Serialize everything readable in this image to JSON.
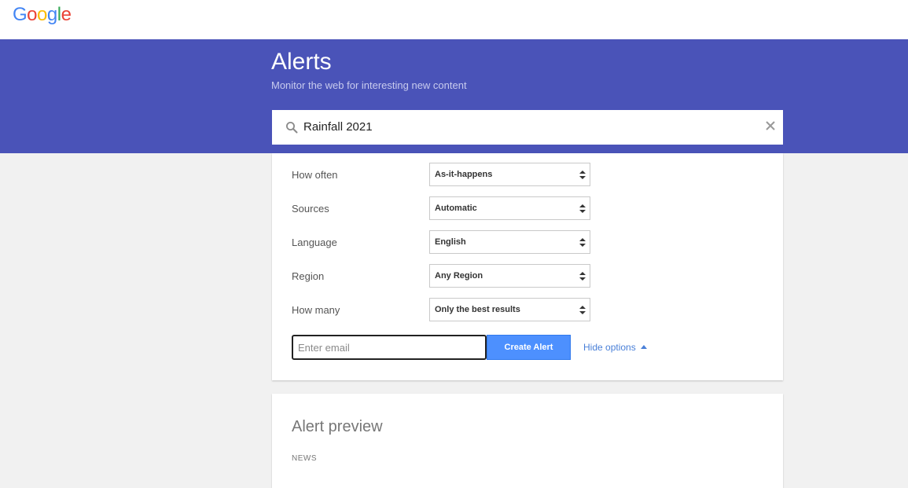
{
  "brand": {
    "logo_letters": [
      "G",
      "o",
      "o",
      "g",
      "l",
      "e"
    ],
    "logo_colors": [
      "#4285f4",
      "#ea4335",
      "#fbbc05",
      "#4285f4",
      "#34a853",
      "#ea4335"
    ]
  },
  "header": {
    "title": "Alerts",
    "subtitle": "Monitor the web for interesting new content",
    "background": "#4a53b8"
  },
  "search": {
    "query": "Rainfall 2021",
    "search_icon": "search-icon",
    "clear_icon": "close-icon"
  },
  "options": [
    {
      "label": "How often",
      "value": "As-it-happens"
    },
    {
      "label": "Sources",
      "value": "Automatic"
    },
    {
      "label": "Language",
      "value": "English"
    },
    {
      "label": "Region",
      "value": "Any Region"
    },
    {
      "label": "How many",
      "value": "Only the best results"
    }
  ],
  "email": {
    "placeholder": "Enter email"
  },
  "actions": {
    "create_label": "Create Alert",
    "create_color": "#4d90fe",
    "hide_options_label": "Hide options"
  },
  "preview": {
    "title": "Alert preview",
    "section": "NEWS"
  }
}
